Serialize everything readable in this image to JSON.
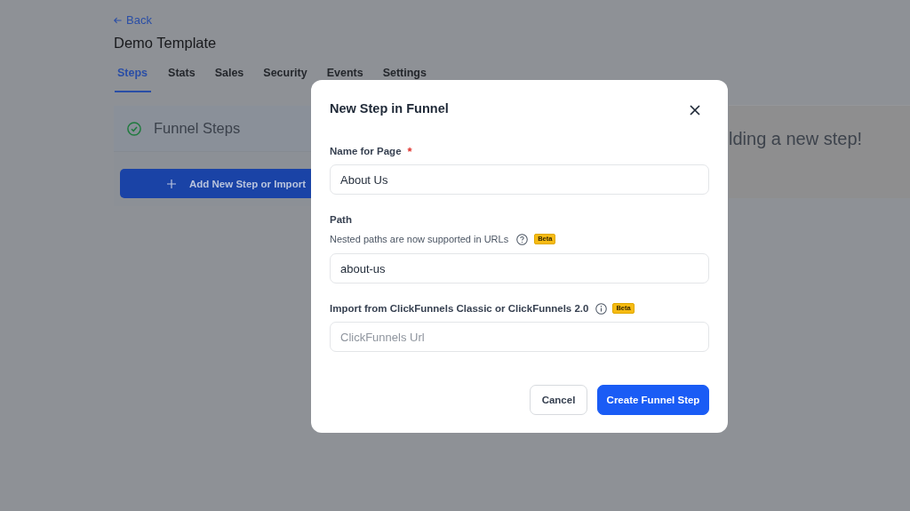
{
  "back_link": {
    "label": "Back"
  },
  "page_title": "Demo Template",
  "tabs": [
    {
      "label": "Steps",
      "selected": true
    },
    {
      "label": "Stats",
      "selected": false
    },
    {
      "label": "Sales",
      "selected": false
    },
    {
      "label": "Security",
      "selected": false
    },
    {
      "label": "Events",
      "selected": false
    },
    {
      "label": "Settings",
      "selected": false
    }
  ],
  "funnel_steps_panel": {
    "title": "Funnel Steps",
    "add_button": "Add New Step or Import"
  },
  "info_panel": {
    "text": "lding a new step!"
  },
  "modal": {
    "title": "New Step in Funnel",
    "fields": [
      {
        "label": "Name for Page",
        "required_mark": "*",
        "value": "About Us"
      },
      {
        "label": "Path",
        "hint": "Nested paths are now supported in URLs",
        "help_icon": {
          "kind": "question"
        },
        "badge": "Beta",
        "value": "about-us"
      },
      {
        "label": "Import from ClickFunnels Classic or ClickFunnels 2.0",
        "help_icon": {
          "kind": "info"
        },
        "badge": "Beta",
        "placeholder": "ClickFunnels Url"
      }
    ],
    "buttons": [
      {
        "label": "Cancel",
        "kind": "secondary"
      },
      {
        "label": "Create Funnel Step",
        "kind": "primary"
      }
    ]
  }
}
